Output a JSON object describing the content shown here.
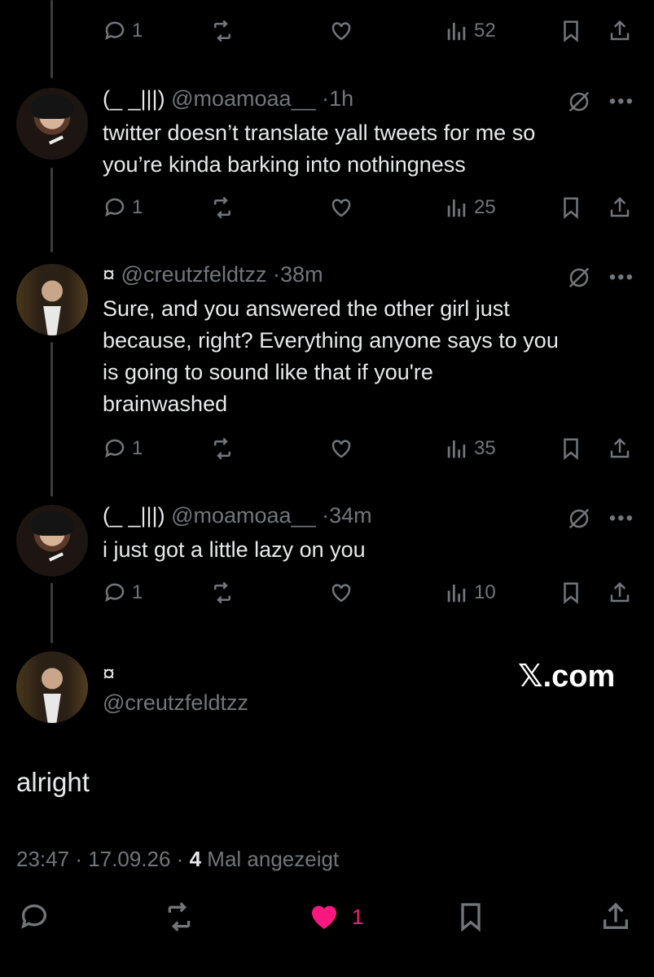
{
  "top_tweet": {
    "replies": "1",
    "views": "52"
  },
  "tweets": [
    {
      "display_name": "(_ _|||)",
      "handle": "@moamoaa__",
      "time": "1h",
      "text_lines": [
        "twitter doesn’t translate yall tweets for me so",
        "you’re kinda barking into nothingness"
      ],
      "replies": "1",
      "views": "25"
    },
    {
      "display_name": "¤",
      "handle": "@creutzfeldtzz",
      "time": "38m",
      "text_lines": [
        "Sure, and you answered the other girl just",
        "because, right? Everything anyone says to you",
        "is going to sound like that if you're",
        "brainwashed"
      ],
      "replies": "1",
      "views": "35"
    },
    {
      "display_name": "(_ _|||)",
      "handle": "@moamoaa__",
      "time": "34m",
      "text_lines": [
        "i just got a little lazy on you"
      ],
      "replies": "1",
      "views": "10"
    }
  ],
  "main_tweet": {
    "display_name": "¤",
    "handle": "@creutzfeldtzz",
    "watermark": "𝕏.com",
    "text": "alright",
    "time": "23:47",
    "date": "17.09.26",
    "views_count": "4",
    "views_label": "Mal angezeigt",
    "likes": "1"
  },
  "colors": {
    "background": "#000000",
    "text": "#e7e9ea",
    "muted": "#71767b",
    "like": "#f91880"
  },
  "icons": [
    "reply-icon",
    "retweet-icon",
    "like-icon",
    "views-icon",
    "bookmark-icon",
    "share-icon",
    "grok-icon",
    "more-icon"
  ]
}
